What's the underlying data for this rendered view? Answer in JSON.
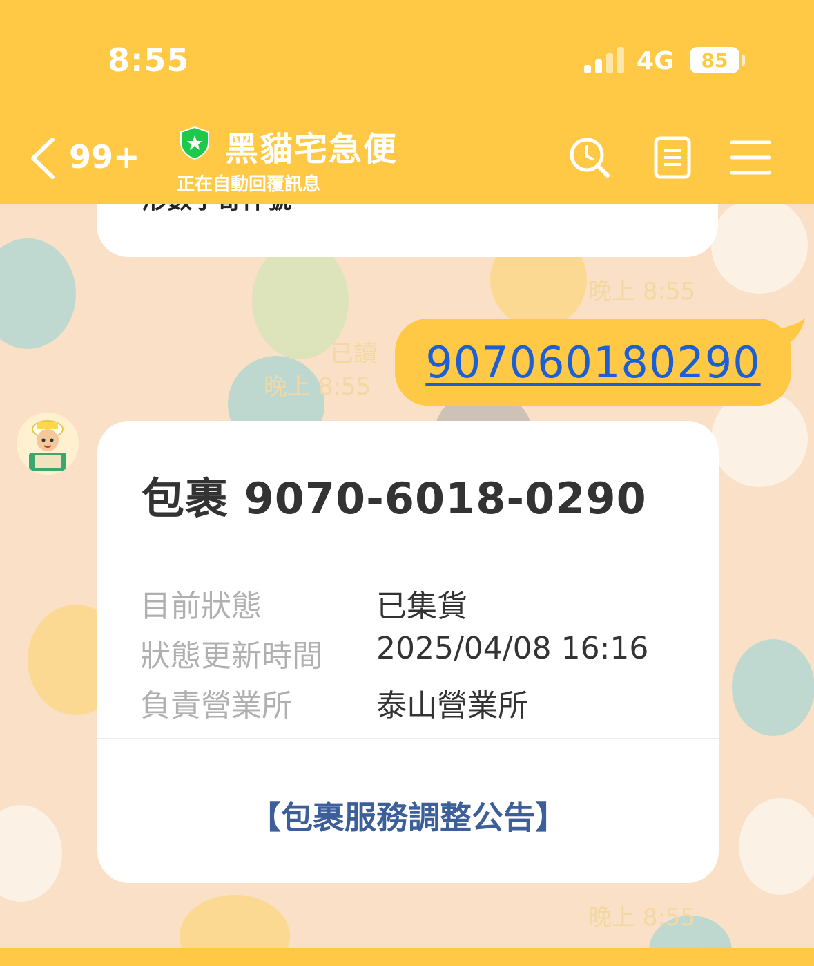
{
  "status_bar": {
    "time": "8:55",
    "network": "4G",
    "battery": "85"
  },
  "header": {
    "back_count": "99+",
    "title": "黑貓宅急便",
    "subtitle": "正在自動回覆訊息"
  },
  "icons": {
    "back": "chevron-left-icon",
    "verified": "shield-star-icon",
    "search": "search-icon",
    "notes": "notes-icon",
    "menu": "menu-icon"
  },
  "messages": {
    "previous_partial_text": "形數字寄件號",
    "previous_time": "晚上 8:55",
    "sent": {
      "read_label": "已讀",
      "time": "晚上 8:55",
      "text": "9070601802​90"
    },
    "card": {
      "title": "包裹 9070-6018-0290",
      "rows": [
        {
          "label": "目前狀態",
          "value": "已集貨"
        },
        {
          "label": "狀態更新時間",
          "value": "2025/04/08 16:16"
        },
        {
          "label": "負責營業所",
          "value": "泰山營業所"
        }
      ],
      "notice_link": "【包裹服務調整公告】"
    },
    "card_time": "晚上 8:55"
  },
  "colors": {
    "header": "#ffc845",
    "chat_background": "#f9e0c6",
    "link": "#1a5fd6",
    "notice": "#3c5f9a"
  }
}
